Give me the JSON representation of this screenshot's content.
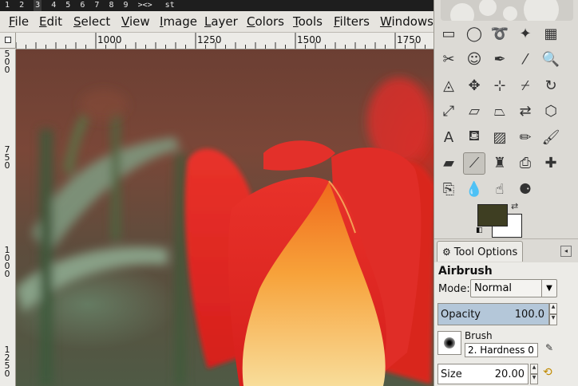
{
  "workspace_bar": {
    "items": [
      "1",
      "2",
      "3",
      "4",
      "5",
      "6",
      "7",
      "8",
      "9",
      "><>"
    ],
    "window_title": "st"
  },
  "menubar": {
    "items": [
      {
        "label": "File",
        "mnemonic": "F",
        "rest": "ile"
      },
      {
        "label": "Edit",
        "mnemonic": "E",
        "rest": "dit"
      },
      {
        "label": "Select",
        "mnemonic": "S",
        "rest": "elect"
      },
      {
        "label": "View",
        "mnemonic": "V",
        "rest": "iew"
      },
      {
        "label": "Image",
        "mnemonic": "I",
        "rest": "mage"
      },
      {
        "label": "Layer",
        "mnemonic": "L",
        "rest": "ayer"
      },
      {
        "label": "Colors",
        "mnemonic": "C",
        "rest": "olors"
      },
      {
        "label": "Tools",
        "mnemonic": "T",
        "rest": "ools"
      },
      {
        "label": "Filters",
        "mnemonic": "F",
        "rest": "ilters"
      },
      {
        "label": "Windows",
        "mnemonic": "W",
        "rest": "indows"
      }
    ]
  },
  "ruler": {
    "horizontal": [
      "1000",
      "1250",
      "1500",
      "1750"
    ],
    "vertical": [
      "500",
      "750",
      "1000",
      "1250"
    ]
  },
  "toolbox": {
    "tools": [
      {
        "name": "rect-select",
        "glyph": "▭"
      },
      {
        "name": "ellipse-select",
        "glyph": "◯"
      },
      {
        "name": "free-select",
        "glyph": "➰"
      },
      {
        "name": "fuzzy-select",
        "glyph": "✦"
      },
      {
        "name": "select-by-color",
        "glyph": "▦"
      },
      {
        "name": "scissors-select",
        "glyph": "✂"
      },
      {
        "name": "foreground-select",
        "glyph": "☺"
      },
      {
        "name": "paths",
        "glyph": "✒"
      },
      {
        "name": "color-picker",
        "glyph": "⁄"
      },
      {
        "name": "zoom",
        "glyph": "🔍"
      },
      {
        "name": "measure",
        "glyph": "◬"
      },
      {
        "name": "move",
        "glyph": "✥"
      },
      {
        "name": "align",
        "glyph": "⊹"
      },
      {
        "name": "crop",
        "glyph": "⌿"
      },
      {
        "name": "rotate",
        "glyph": "↻"
      },
      {
        "name": "scale",
        "glyph": "⤢"
      },
      {
        "name": "shear",
        "glyph": "▱"
      },
      {
        "name": "perspective",
        "glyph": "⏢"
      },
      {
        "name": "flip",
        "glyph": "⇄"
      },
      {
        "name": "cage-transform",
        "glyph": "⬡"
      },
      {
        "name": "text",
        "glyph": "A"
      },
      {
        "name": "bucket-fill",
        "glyph": "⛾"
      },
      {
        "name": "blend",
        "glyph": "▨"
      },
      {
        "name": "pencil",
        "glyph": "✏"
      },
      {
        "name": "paintbrush",
        "glyph": "🖌"
      },
      {
        "name": "eraser",
        "glyph": "▰"
      },
      {
        "name": "airbrush",
        "glyph": "⟋"
      },
      {
        "name": "ink",
        "glyph": "♜"
      },
      {
        "name": "clone",
        "glyph": "⎙"
      },
      {
        "name": "heal",
        "glyph": "✚"
      },
      {
        "name": "perspective-clone",
        "glyph": "⎘"
      },
      {
        "name": "blur-sharpen",
        "glyph": "💧"
      },
      {
        "name": "smudge",
        "glyph": "☝"
      },
      {
        "name": "dodge-burn",
        "glyph": "⚈"
      }
    ],
    "active_tool": "airbrush",
    "foreground_color": "#3e3e22",
    "background_color": "#ffffff"
  },
  "tool_options": {
    "tab_label": "Tool Options",
    "title": "Airbrush",
    "mode_label": "Mode:",
    "mode_value": "Normal",
    "opacity_label": "Opacity",
    "opacity_value": "100.0",
    "brush_label": "Brush",
    "brush_value": "2. Hardness 0",
    "size_label": "Size",
    "size_value": "20.00"
  }
}
